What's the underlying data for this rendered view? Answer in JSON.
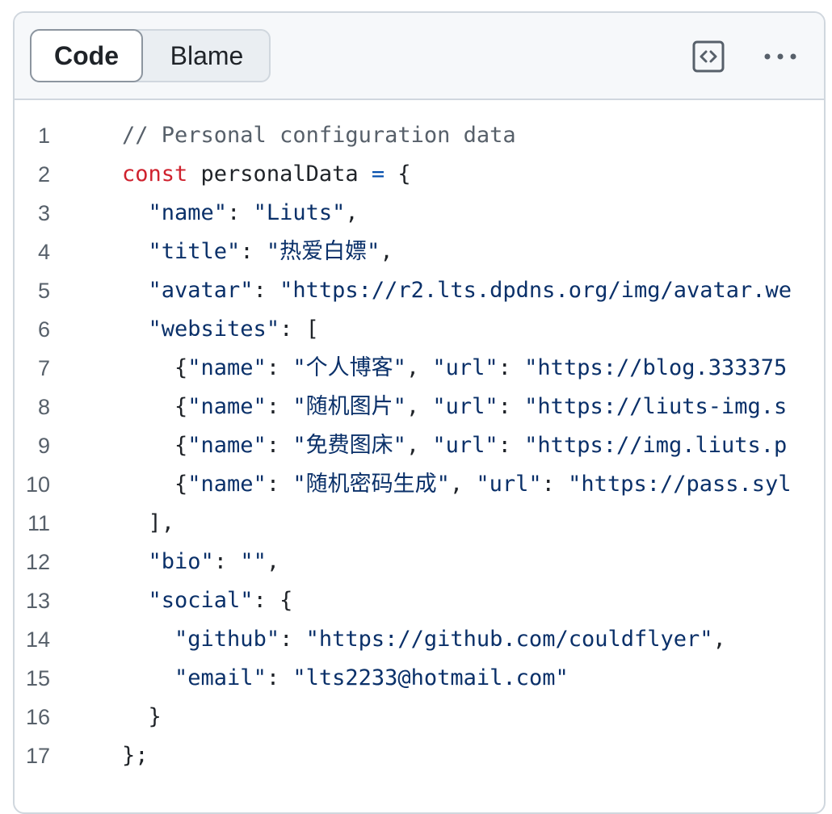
{
  "tabs": {
    "code": "Code",
    "blame": "Blame"
  },
  "actions": {
    "symbols_icon": "code-square-icon",
    "more_icon": "kebab-horizontal-icon"
  },
  "colors": {
    "comment": "#57606a",
    "keyword": "#cf222e",
    "string": "#0a3069",
    "operator": "#0550ae",
    "text": "#1f2328"
  },
  "lines": [
    {
      "n": "1",
      "tokens": [
        [
          "cm",
          "// Personal configuration data"
        ]
      ]
    },
    {
      "n": "2",
      "tokens": [
        [
          "kw",
          "const"
        ],
        [
          "id",
          " personalData "
        ],
        [
          "op",
          "="
        ],
        [
          "pn",
          " {"
        ]
      ]
    },
    {
      "n": "3",
      "tokens": [
        [
          "pn",
          "  "
        ],
        [
          "st",
          "\"name\""
        ],
        [
          "pn",
          ": "
        ],
        [
          "st",
          "\"Liuts\""
        ],
        [
          "pn",
          ","
        ]
      ]
    },
    {
      "n": "4",
      "tokens": [
        [
          "pn",
          "  "
        ],
        [
          "st",
          "\"title\""
        ],
        [
          "pn",
          ": "
        ],
        [
          "st",
          "\"热爱白嫖\""
        ],
        [
          "pn",
          ","
        ]
      ]
    },
    {
      "n": "5",
      "tokens": [
        [
          "pn",
          "  "
        ],
        [
          "st",
          "\"avatar\""
        ],
        [
          "pn",
          ": "
        ],
        [
          "st",
          "\"https://r2.lts.dpdns.org/img/avatar.we"
        ]
      ]
    },
    {
      "n": "6",
      "tokens": [
        [
          "pn",
          "  "
        ],
        [
          "st",
          "\"websites\""
        ],
        [
          "pn",
          ": ["
        ]
      ]
    },
    {
      "n": "7",
      "tokens": [
        [
          "pn",
          "    {"
        ],
        [
          "st",
          "\"name\""
        ],
        [
          "pn",
          ": "
        ],
        [
          "st",
          "\"个人博客\""
        ],
        [
          "pn",
          ", "
        ],
        [
          "st",
          "\"url\""
        ],
        [
          "pn",
          ": "
        ],
        [
          "st",
          "\"https://blog.333375"
        ]
      ]
    },
    {
      "n": "8",
      "tokens": [
        [
          "pn",
          "    {"
        ],
        [
          "st",
          "\"name\""
        ],
        [
          "pn",
          ": "
        ],
        [
          "st",
          "\"随机图片\""
        ],
        [
          "pn",
          ", "
        ],
        [
          "st",
          "\"url\""
        ],
        [
          "pn",
          ": "
        ],
        [
          "st",
          "\"https://liuts-img.s"
        ]
      ]
    },
    {
      "n": "9",
      "tokens": [
        [
          "pn",
          "    {"
        ],
        [
          "st",
          "\"name\""
        ],
        [
          "pn",
          ": "
        ],
        [
          "st",
          "\"免费图床\""
        ],
        [
          "pn",
          ", "
        ],
        [
          "st",
          "\"url\""
        ],
        [
          "pn",
          ": "
        ],
        [
          "st",
          "\"https://img.liuts.p"
        ]
      ]
    },
    {
      "n": "10",
      "tokens": [
        [
          "pn",
          "    {"
        ],
        [
          "st",
          "\"name\""
        ],
        [
          "pn",
          ": "
        ],
        [
          "st",
          "\"随机密码生成\""
        ],
        [
          "pn",
          ", "
        ],
        [
          "st",
          "\"url\""
        ],
        [
          "pn",
          ": "
        ],
        [
          "st",
          "\"https://pass.syl"
        ]
      ]
    },
    {
      "n": "11",
      "tokens": [
        [
          "pn",
          "  ],"
        ]
      ]
    },
    {
      "n": "12",
      "tokens": [
        [
          "pn",
          "  "
        ],
        [
          "st",
          "\"bio\""
        ],
        [
          "pn",
          ": "
        ],
        [
          "st",
          "\"\""
        ],
        [
          "pn",
          ","
        ]
      ]
    },
    {
      "n": "13",
      "tokens": [
        [
          "pn",
          "  "
        ],
        [
          "st",
          "\"social\""
        ],
        [
          "pn",
          ": {"
        ]
      ]
    },
    {
      "n": "14",
      "tokens": [
        [
          "pn",
          "    "
        ],
        [
          "st",
          "\"github\""
        ],
        [
          "pn",
          ": "
        ],
        [
          "st",
          "\"https://github.com/couldflyer\""
        ],
        [
          "pn",
          ","
        ]
      ]
    },
    {
      "n": "15",
      "tokens": [
        [
          "pn",
          "    "
        ],
        [
          "st",
          "\"email\""
        ],
        [
          "pn",
          ": "
        ],
        [
          "st",
          "\"lts2233@hotmail.com\""
        ]
      ]
    },
    {
      "n": "16",
      "tokens": [
        [
          "pn",
          "  }"
        ]
      ]
    },
    {
      "n": "17",
      "tokens": [
        [
          "pn",
          "};"
        ]
      ]
    }
  ]
}
